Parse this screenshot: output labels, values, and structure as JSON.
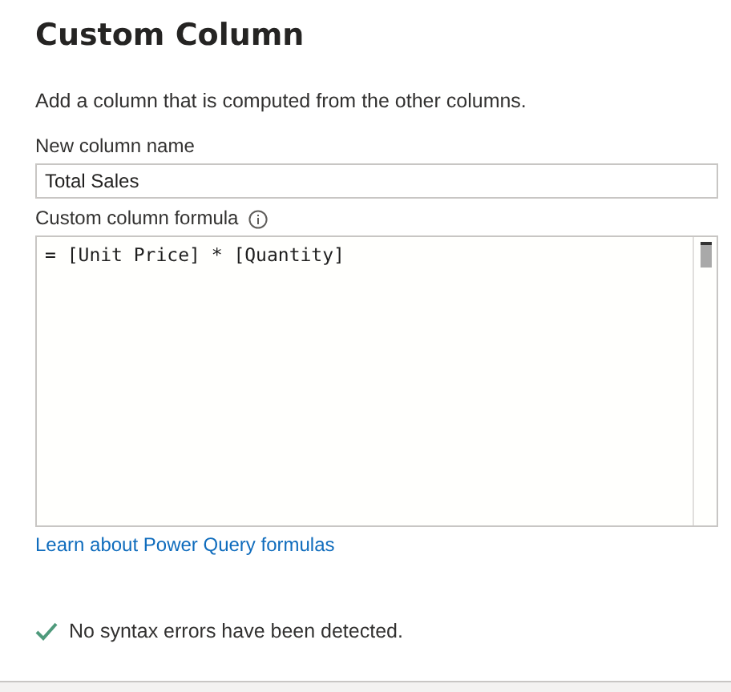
{
  "title": "Custom Column",
  "description": "Add a column that is computed from the other columns.",
  "name_field": {
    "label": "New column name",
    "value": "Total Sales"
  },
  "formula_field": {
    "label": "Custom column formula",
    "value": "= [Unit Price] * [Quantity]"
  },
  "link": "Learn about Power Query formulas",
  "status": {
    "ok": true,
    "message": "No syntax errors have been detected."
  }
}
